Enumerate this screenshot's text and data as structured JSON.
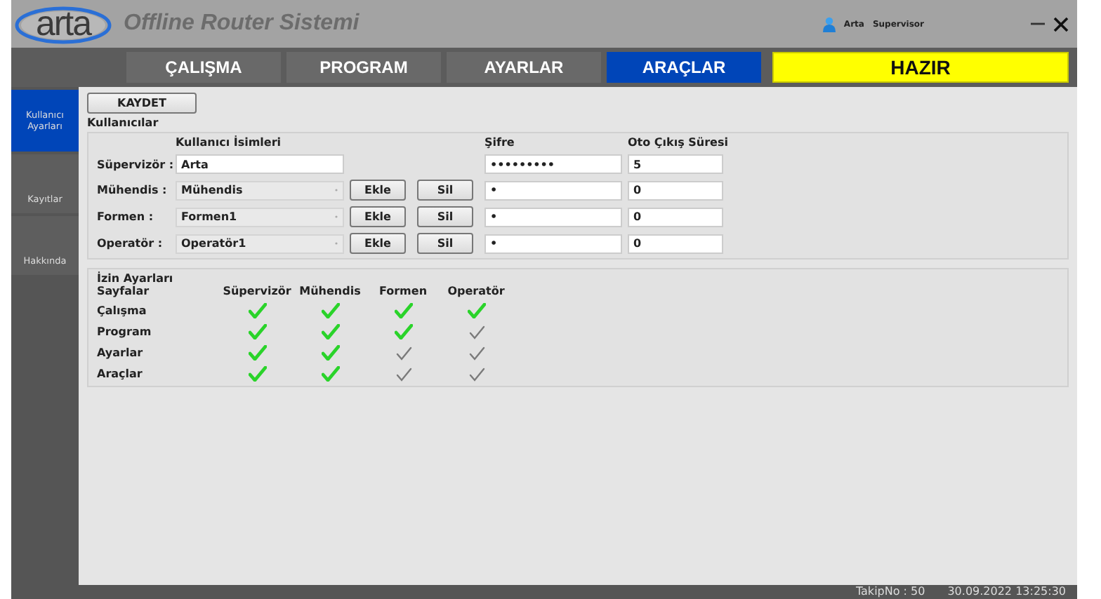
{
  "app": {
    "logo": "arta",
    "title": "Offline Router Sistemi",
    "user_name": "Arta",
    "user_role": "Supervisor"
  },
  "nav_tabs": [
    {
      "label": "ÇALIŞMA",
      "selected": false
    },
    {
      "label": "PROGRAM",
      "selected": false
    },
    {
      "label": "AYARLAR",
      "selected": false
    },
    {
      "label": "ARAÇLAR",
      "selected": true
    }
  ],
  "status_badge": "HAZIR",
  "sidebar": {
    "items": [
      {
        "label": "Kullanıcı Ayarları",
        "selected": true
      },
      {
        "label": "Kayıtlar",
        "selected": false
      },
      {
        "label": "Hakkında",
        "selected": false
      }
    ]
  },
  "save_button": "KAYDET",
  "users": {
    "title": "Kullanıcılar",
    "columns": [
      "Kullanıcı İsimleri",
      "Şifre",
      "Oto Çıkış Süresi"
    ],
    "rows": [
      {
        "kind": "text",
        "role": "Süpervizör :",
        "name": "Arta",
        "password": "•••••••••",
        "timeout": "5"
      },
      {
        "kind": "select",
        "role": "Mühendis :",
        "name": "Mühendis",
        "add_label": "Ekle",
        "delete_label": "Sil",
        "password": "•",
        "timeout": "0"
      },
      {
        "kind": "select",
        "role": "Formen :",
        "name": "Formen1",
        "add_label": "Ekle",
        "delete_label": "Sil",
        "password": "•",
        "timeout": "0"
      },
      {
        "kind": "select",
        "role": "Operatör :",
        "name": "Operatör1",
        "add_label": "Ekle",
        "delete_label": "Sil",
        "password": "•",
        "timeout": "0"
      }
    ]
  },
  "permissions": {
    "title": "İzin Ayarları",
    "columns": [
      "Sayfalar",
      "Süpervizör",
      "Mühendis",
      "Formen",
      "Operatör"
    ],
    "rows": [
      {
        "page": "Çalışma",
        "granted": [
          true,
          true,
          true,
          true
        ]
      },
      {
        "page": "Program",
        "granted": [
          true,
          true,
          true,
          false
        ]
      },
      {
        "page": "Ayarlar",
        "granted": [
          true,
          true,
          false,
          false
        ]
      },
      {
        "page": "Araçlar",
        "granted": [
          true,
          true,
          false,
          false
        ]
      }
    ]
  },
  "status_bar": {
    "tracking": "TakipNo : 50",
    "datetime": "30.09.2022 13:25:30"
  }
}
